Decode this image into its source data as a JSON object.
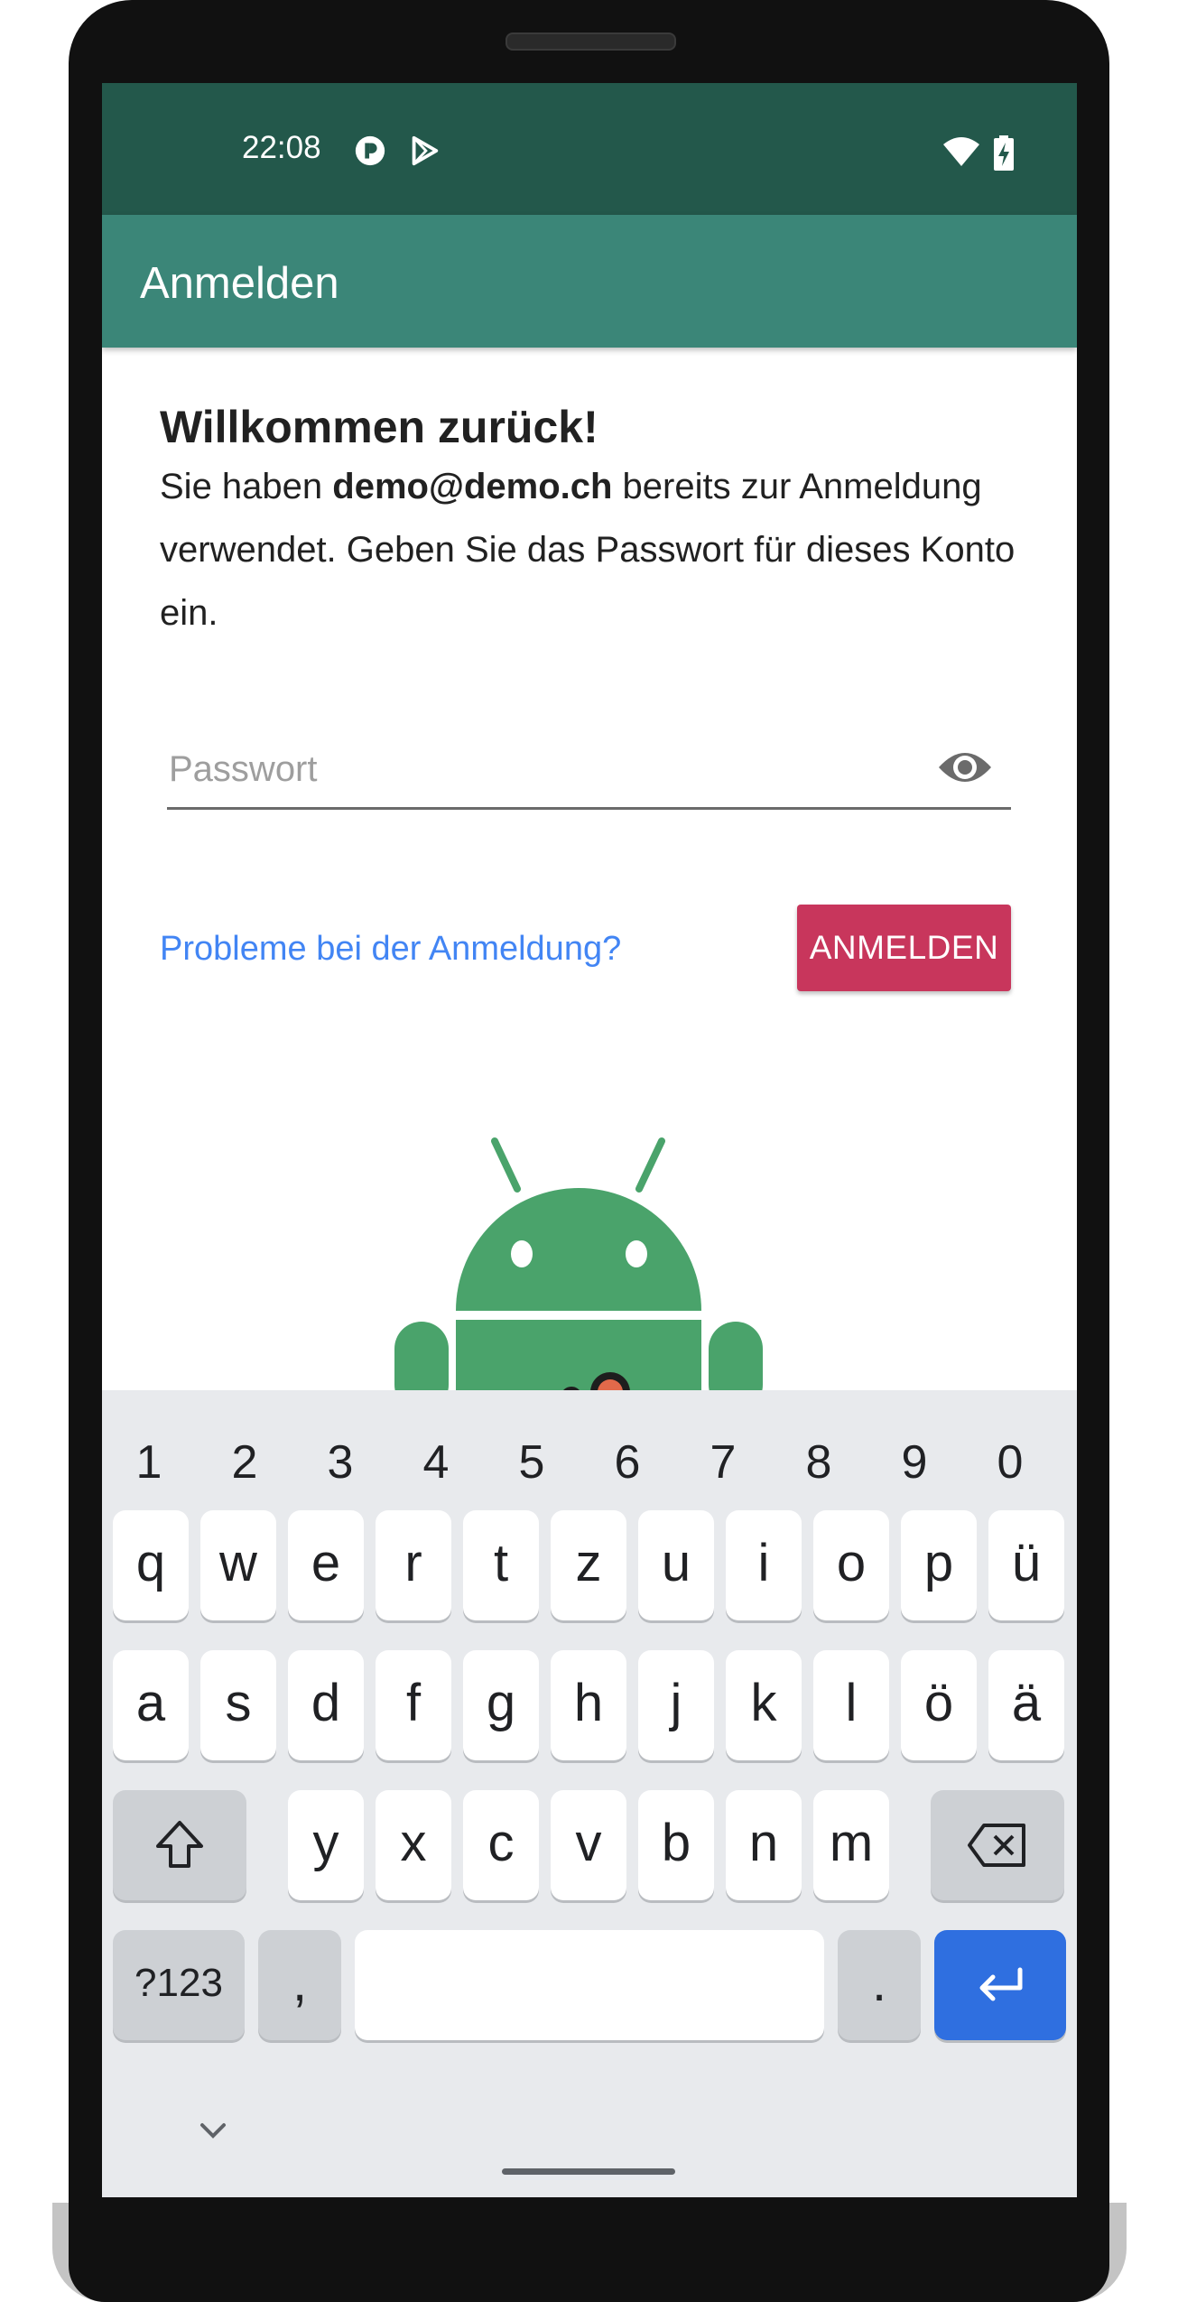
{
  "status_bar": {
    "time": "22:08"
  },
  "app_bar": {
    "title": "Anmelden"
  },
  "welcome": {
    "title": "Willkommen zurück!",
    "text_before": "Sie haben ",
    "email": "demo@demo.ch",
    "text_after": " bereits zur Anmeldung verwendet. Geben Sie das Passwort für dieses Konto ein."
  },
  "password": {
    "placeholder": "Passwort",
    "value": ""
  },
  "trouble_link": "Probleme bei der Anmeldung?",
  "signin_button": "ANMELDEN",
  "keyboard": {
    "numbers": [
      "1",
      "2",
      "3",
      "4",
      "5",
      "6",
      "7",
      "8",
      "9",
      "0"
    ],
    "row1": [
      "q",
      "w",
      "e",
      "r",
      "t",
      "z",
      "u",
      "i",
      "o",
      "p",
      "ü"
    ],
    "row2": [
      "a",
      "s",
      "d",
      "f",
      "g",
      "h",
      "j",
      "k",
      "l",
      "ö",
      "ä"
    ],
    "row3": [
      "y",
      "x",
      "c",
      "v",
      "b",
      "n",
      "m"
    ],
    "symbols_key": "?123",
    "comma_key": ",",
    "period_key": "."
  },
  "colors": {
    "status_bar": "#23584b",
    "app_bar": "#3b8678",
    "accent_button": "#c8365c",
    "link": "#4285f4",
    "enter_key": "#2f6fe0",
    "android_green": "#4aa36b"
  }
}
